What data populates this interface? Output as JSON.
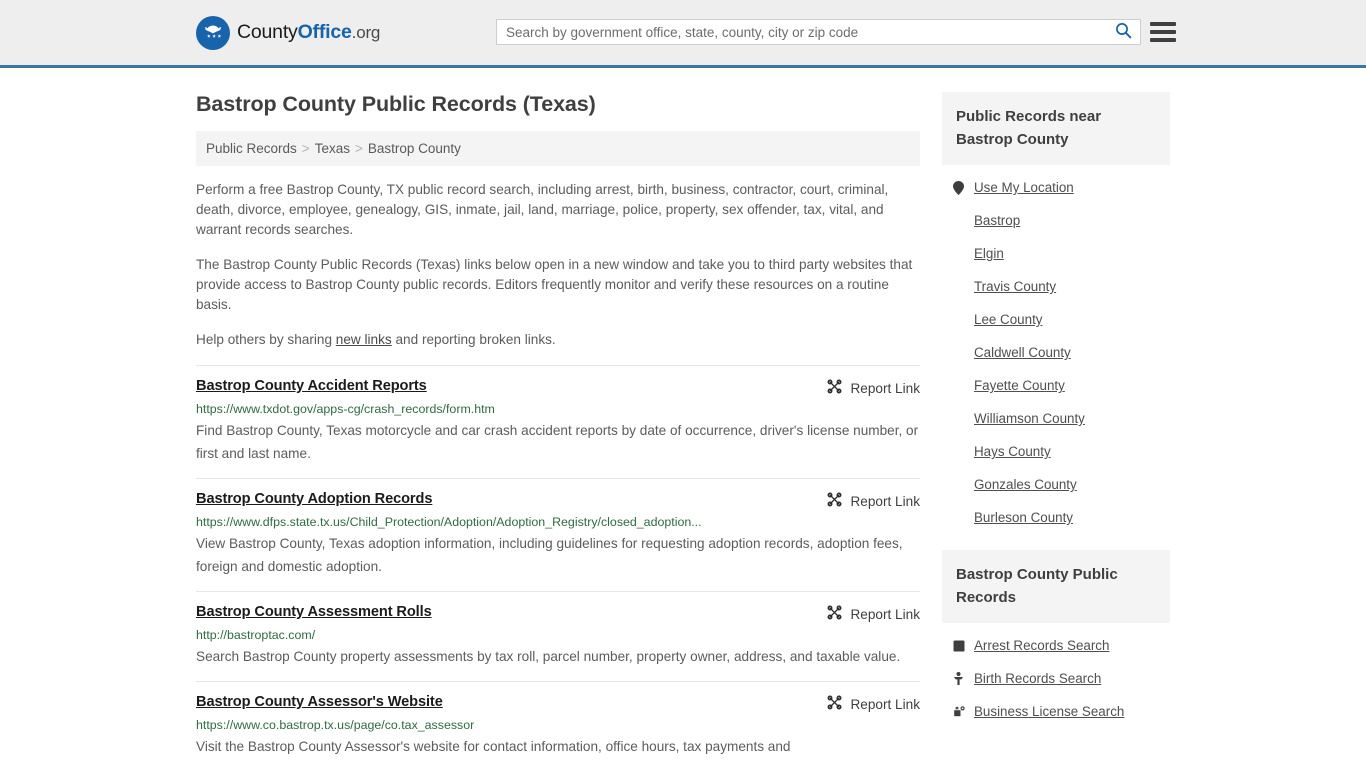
{
  "header": {
    "logo": {
      "icon": "eagle-shield-icon",
      "text_part1": "County",
      "text_part2": "Office",
      "text_part3": ".org"
    },
    "search": {
      "placeholder": "Search by government office, state, county, city or zip code",
      "value": "",
      "search_icon": "search-icon"
    },
    "menu_icon": "hamburger-menu-icon",
    "accent_color": "#3a76a8"
  },
  "main": {
    "title": "Bastrop County Public Records (Texas)",
    "breadcrumb": [
      {
        "label": "Public Records"
      },
      {
        "label": "Texas"
      },
      {
        "label": "Bastrop County"
      }
    ],
    "breadcrumb_separator": ">",
    "intro": {
      "p1": "Perform a free Bastrop County, TX public record search, including arrest, birth, business, contractor, court, criminal, death, divorce, employee, genealogy, GIS, inmate, jail, land, marriage, police, property, sex offender, tax, vital, and warrant records searches.",
      "p2": "The Bastrop County Public Records (Texas) links below open in a new window and take you to third party websites that provide access to Bastrop County public records. Editors frequently monitor and verify these resources on a routine basis.",
      "p3_before": "Help others by sharing ",
      "p3_link": "new links",
      "p3_after": " and reporting broken links."
    },
    "report_link_label": "Report Link",
    "report_link_icon": "broken-link-icon",
    "results": [
      {
        "title": "Bastrop County Accident Reports",
        "url": "https://www.txdot.gov/apps-cg/crash_records/form.htm",
        "description": "Find Bastrop County, Texas motorcycle and car crash accident reports by date of occurrence, driver's license number, or first and last name."
      },
      {
        "title": "Bastrop County Adoption Records",
        "url": "https://www.dfps.state.tx.us/Child_Protection/Adoption/Adoption_Registry/closed_adoption...",
        "description": "View Bastrop County, Texas adoption information, including guidelines for requesting adoption records, adoption fees, foreign and domestic adoption."
      },
      {
        "title": "Bastrop County Assessment Rolls",
        "url": "http://bastroptac.com/",
        "description": "Search Bastrop County property assessments by tax roll, parcel number, property owner, address, and taxable value."
      },
      {
        "title": "Bastrop County Assessor's Website",
        "url": "https://www.co.bastrop.tx.us/page/co.tax_assessor",
        "description": "Visit the Bastrop County Assessor's website for contact information, office hours, tax payments and"
      }
    ]
  },
  "sidebar": {
    "nearby_panel": {
      "title": "Public Records near Bastrop County",
      "items": [
        {
          "label": "Use My Location",
          "icon": "map-pin-icon"
        },
        {
          "label": "Bastrop",
          "icon": ""
        },
        {
          "label": "Elgin",
          "icon": ""
        },
        {
          "label": "Travis County",
          "icon": ""
        },
        {
          "label": "Lee County",
          "icon": ""
        },
        {
          "label": "Caldwell County",
          "icon": ""
        },
        {
          "label": "Fayette County",
          "icon": ""
        },
        {
          "label": "Williamson County",
          "icon": ""
        },
        {
          "label": "Hays County",
          "icon": ""
        },
        {
          "label": "Gonzales County",
          "icon": ""
        },
        {
          "label": "Burleson County",
          "icon": ""
        }
      ]
    },
    "records_panel": {
      "title": "Bastrop County Public Records",
      "items": [
        {
          "label": "Arrest Records Search",
          "icon": "badge-icon"
        },
        {
          "label": "Birth Records Search",
          "icon": "baby-icon"
        },
        {
          "label": "Business License Search",
          "icon": "briefcase-icon"
        }
      ]
    }
  }
}
